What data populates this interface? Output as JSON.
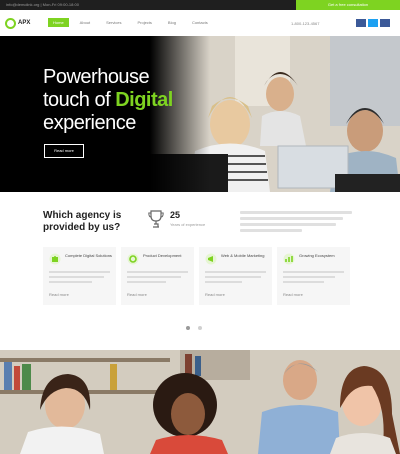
{
  "topbar": {
    "contact_info": "info@demolink.org  |  Mon-Fri 09:00-18:00",
    "cta_label": "Get a free consultation"
  },
  "brand": {
    "name": "APX"
  },
  "nav": {
    "items": [
      "Home",
      "About",
      "Services",
      "Projects",
      "Blog",
      "Contacts"
    ],
    "active_index": 0,
    "phone": "1-800-123-4567"
  },
  "hero": {
    "title_line1": "Powerhouse",
    "title_line2_prefix": "touch of ",
    "title_line2_highlight": "Digital",
    "title_line3": "experience",
    "button_label": "Read more"
  },
  "why": {
    "heading": "Which agency is provided by us?",
    "stat_number": "25",
    "stat_label": "Years of experience"
  },
  "cards": [
    {
      "title": "Complete Digital Solutions",
      "more": "Read more"
    },
    {
      "title": "Product Development",
      "more": "Read more"
    },
    {
      "title": "Web & Mobile Marketing",
      "more": "Read more"
    },
    {
      "title": "Growing Ecosystem",
      "more": "Read more"
    }
  ],
  "colors": {
    "accent": "#7ed321",
    "dark": "#1f1f1f",
    "facebook": "#3b5998",
    "twitter": "#1da1f2"
  }
}
